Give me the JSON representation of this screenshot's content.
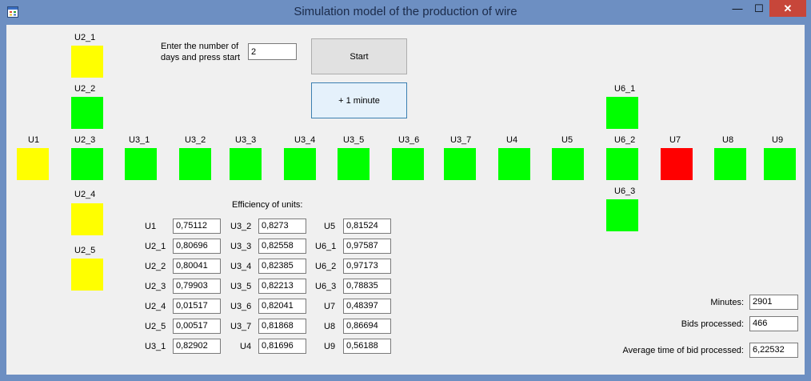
{
  "window": {
    "title": "Simulation model of the production of wire"
  },
  "titlebar_buttons": {
    "minimize": "—",
    "maximize": "☐",
    "close": "✕"
  },
  "controls": {
    "prompt": "Enter the number of days and press start",
    "prompt_line1": "Enter the number of",
    "prompt_line2": "days and press start",
    "days_value": "2",
    "start_label": "Start",
    "plus_minute_label": "+ 1 minute"
  },
  "colors": {
    "yellow": "#ffff00",
    "green": "#00ff00",
    "red": "#ff0000"
  },
  "units": [
    {
      "name": "U2_1",
      "state": "yellow"
    },
    {
      "name": "U2_2",
      "state": "green"
    },
    {
      "name": "U1",
      "state": "yellow"
    },
    {
      "name": "U2_3",
      "state": "green"
    },
    {
      "name": "U3_1",
      "state": "green"
    },
    {
      "name": "U3_2",
      "state": "green"
    },
    {
      "name": "U3_3",
      "state": "green"
    },
    {
      "name": "U3_4",
      "state": "green"
    },
    {
      "name": "U3_5",
      "state": "green"
    },
    {
      "name": "U3_6",
      "state": "green"
    },
    {
      "name": "U3_7",
      "state": "green"
    },
    {
      "name": "U4",
      "state": "green"
    },
    {
      "name": "U5",
      "state": "green"
    },
    {
      "name": "U6_2",
      "state": "green"
    },
    {
      "name": "U7",
      "state": "red"
    },
    {
      "name": "U8",
      "state": "green"
    },
    {
      "name": "U9",
      "state": "green"
    },
    {
      "name": "U2_4",
      "state": "yellow"
    },
    {
      "name": "U2_5",
      "state": "yellow"
    },
    {
      "name": "U6_1",
      "state": "green"
    },
    {
      "name": "U6_3",
      "state": "green"
    }
  ],
  "efficiency": {
    "title": "Efficiency of units:",
    "items": [
      {
        "label": "U1",
        "value": "0,75112"
      },
      {
        "label": "U2_1",
        "value": "0,80696"
      },
      {
        "label": "U2_2",
        "value": "0,80041"
      },
      {
        "label": "U2_3",
        "value": "0,79903"
      },
      {
        "label": "U2_4",
        "value": "0,01517"
      },
      {
        "label": "U2_5",
        "value": "0,00517"
      },
      {
        "label": "U3_1",
        "value": "0,82902"
      },
      {
        "label": "U3_2",
        "value": "0,8273"
      },
      {
        "label": "U3_3",
        "value": "0,82558"
      },
      {
        "label": "U3_4",
        "value": "0,82385"
      },
      {
        "label": "U3_5",
        "value": "0,82213"
      },
      {
        "label": "U3_6",
        "value": "0,82041"
      },
      {
        "label": "U3_7",
        "value": "0,81868"
      },
      {
        "label": "U4",
        "value": "0,81696"
      },
      {
        "label": "U5",
        "value": "0,81524"
      },
      {
        "label": "U6_1",
        "value": "0,97587"
      },
      {
        "label": "U6_2",
        "value": "0,97173"
      },
      {
        "label": "U6_3",
        "value": "0,78835"
      },
      {
        "label": "U7",
        "value": "0,48397"
      },
      {
        "label": "U8",
        "value": "0,86694"
      },
      {
        "label": "U9",
        "value": "0,56188"
      }
    ]
  },
  "stats": [
    {
      "label": "Minutes:",
      "value": "2901"
    },
    {
      "label": "Bids processed:",
      "value": "466"
    },
    {
      "label": "Average time of bid processed:",
      "value": "6,22532"
    }
  ]
}
